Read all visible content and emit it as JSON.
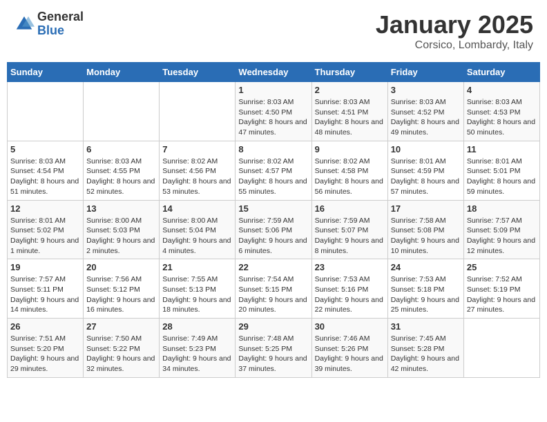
{
  "logo": {
    "general": "General",
    "blue": "Blue"
  },
  "title": "January 2025",
  "subtitle": "Corsico, Lombardy, Italy",
  "weekdays": [
    "Sunday",
    "Monday",
    "Tuesday",
    "Wednesday",
    "Thursday",
    "Friday",
    "Saturday"
  ],
  "weeks": [
    [
      {
        "day": "",
        "info": ""
      },
      {
        "day": "",
        "info": ""
      },
      {
        "day": "",
        "info": ""
      },
      {
        "day": "1",
        "info": "Sunrise: 8:03 AM\nSunset: 4:50 PM\nDaylight: 8 hours and 47 minutes."
      },
      {
        "day": "2",
        "info": "Sunrise: 8:03 AM\nSunset: 4:51 PM\nDaylight: 8 hours and 48 minutes."
      },
      {
        "day": "3",
        "info": "Sunrise: 8:03 AM\nSunset: 4:52 PM\nDaylight: 8 hours and 49 minutes."
      },
      {
        "day": "4",
        "info": "Sunrise: 8:03 AM\nSunset: 4:53 PM\nDaylight: 8 hours and 50 minutes."
      }
    ],
    [
      {
        "day": "5",
        "info": "Sunrise: 8:03 AM\nSunset: 4:54 PM\nDaylight: 8 hours and 51 minutes."
      },
      {
        "day": "6",
        "info": "Sunrise: 8:03 AM\nSunset: 4:55 PM\nDaylight: 8 hours and 52 minutes."
      },
      {
        "day": "7",
        "info": "Sunrise: 8:02 AM\nSunset: 4:56 PM\nDaylight: 8 hours and 53 minutes."
      },
      {
        "day": "8",
        "info": "Sunrise: 8:02 AM\nSunset: 4:57 PM\nDaylight: 8 hours and 55 minutes."
      },
      {
        "day": "9",
        "info": "Sunrise: 8:02 AM\nSunset: 4:58 PM\nDaylight: 8 hours and 56 minutes."
      },
      {
        "day": "10",
        "info": "Sunrise: 8:01 AM\nSunset: 4:59 PM\nDaylight: 8 hours and 57 minutes."
      },
      {
        "day": "11",
        "info": "Sunrise: 8:01 AM\nSunset: 5:01 PM\nDaylight: 8 hours and 59 minutes."
      }
    ],
    [
      {
        "day": "12",
        "info": "Sunrise: 8:01 AM\nSunset: 5:02 PM\nDaylight: 9 hours and 1 minute."
      },
      {
        "day": "13",
        "info": "Sunrise: 8:00 AM\nSunset: 5:03 PM\nDaylight: 9 hours and 2 minutes."
      },
      {
        "day": "14",
        "info": "Sunrise: 8:00 AM\nSunset: 5:04 PM\nDaylight: 9 hours and 4 minutes."
      },
      {
        "day": "15",
        "info": "Sunrise: 7:59 AM\nSunset: 5:06 PM\nDaylight: 9 hours and 6 minutes."
      },
      {
        "day": "16",
        "info": "Sunrise: 7:59 AM\nSunset: 5:07 PM\nDaylight: 9 hours and 8 minutes."
      },
      {
        "day": "17",
        "info": "Sunrise: 7:58 AM\nSunset: 5:08 PM\nDaylight: 9 hours and 10 minutes."
      },
      {
        "day": "18",
        "info": "Sunrise: 7:57 AM\nSunset: 5:09 PM\nDaylight: 9 hours and 12 minutes."
      }
    ],
    [
      {
        "day": "19",
        "info": "Sunrise: 7:57 AM\nSunset: 5:11 PM\nDaylight: 9 hours and 14 minutes."
      },
      {
        "day": "20",
        "info": "Sunrise: 7:56 AM\nSunset: 5:12 PM\nDaylight: 9 hours and 16 minutes."
      },
      {
        "day": "21",
        "info": "Sunrise: 7:55 AM\nSunset: 5:13 PM\nDaylight: 9 hours and 18 minutes."
      },
      {
        "day": "22",
        "info": "Sunrise: 7:54 AM\nSunset: 5:15 PM\nDaylight: 9 hours and 20 minutes."
      },
      {
        "day": "23",
        "info": "Sunrise: 7:53 AM\nSunset: 5:16 PM\nDaylight: 9 hours and 22 minutes."
      },
      {
        "day": "24",
        "info": "Sunrise: 7:53 AM\nSunset: 5:18 PM\nDaylight: 9 hours and 25 minutes."
      },
      {
        "day": "25",
        "info": "Sunrise: 7:52 AM\nSunset: 5:19 PM\nDaylight: 9 hours and 27 minutes."
      }
    ],
    [
      {
        "day": "26",
        "info": "Sunrise: 7:51 AM\nSunset: 5:20 PM\nDaylight: 9 hours and 29 minutes."
      },
      {
        "day": "27",
        "info": "Sunrise: 7:50 AM\nSunset: 5:22 PM\nDaylight: 9 hours and 32 minutes."
      },
      {
        "day": "28",
        "info": "Sunrise: 7:49 AM\nSunset: 5:23 PM\nDaylight: 9 hours and 34 minutes."
      },
      {
        "day": "29",
        "info": "Sunrise: 7:48 AM\nSunset: 5:25 PM\nDaylight: 9 hours and 37 minutes."
      },
      {
        "day": "30",
        "info": "Sunrise: 7:46 AM\nSunset: 5:26 PM\nDaylight: 9 hours and 39 minutes."
      },
      {
        "day": "31",
        "info": "Sunrise: 7:45 AM\nSunset: 5:28 PM\nDaylight: 9 hours and 42 minutes."
      },
      {
        "day": "",
        "info": ""
      }
    ]
  ]
}
